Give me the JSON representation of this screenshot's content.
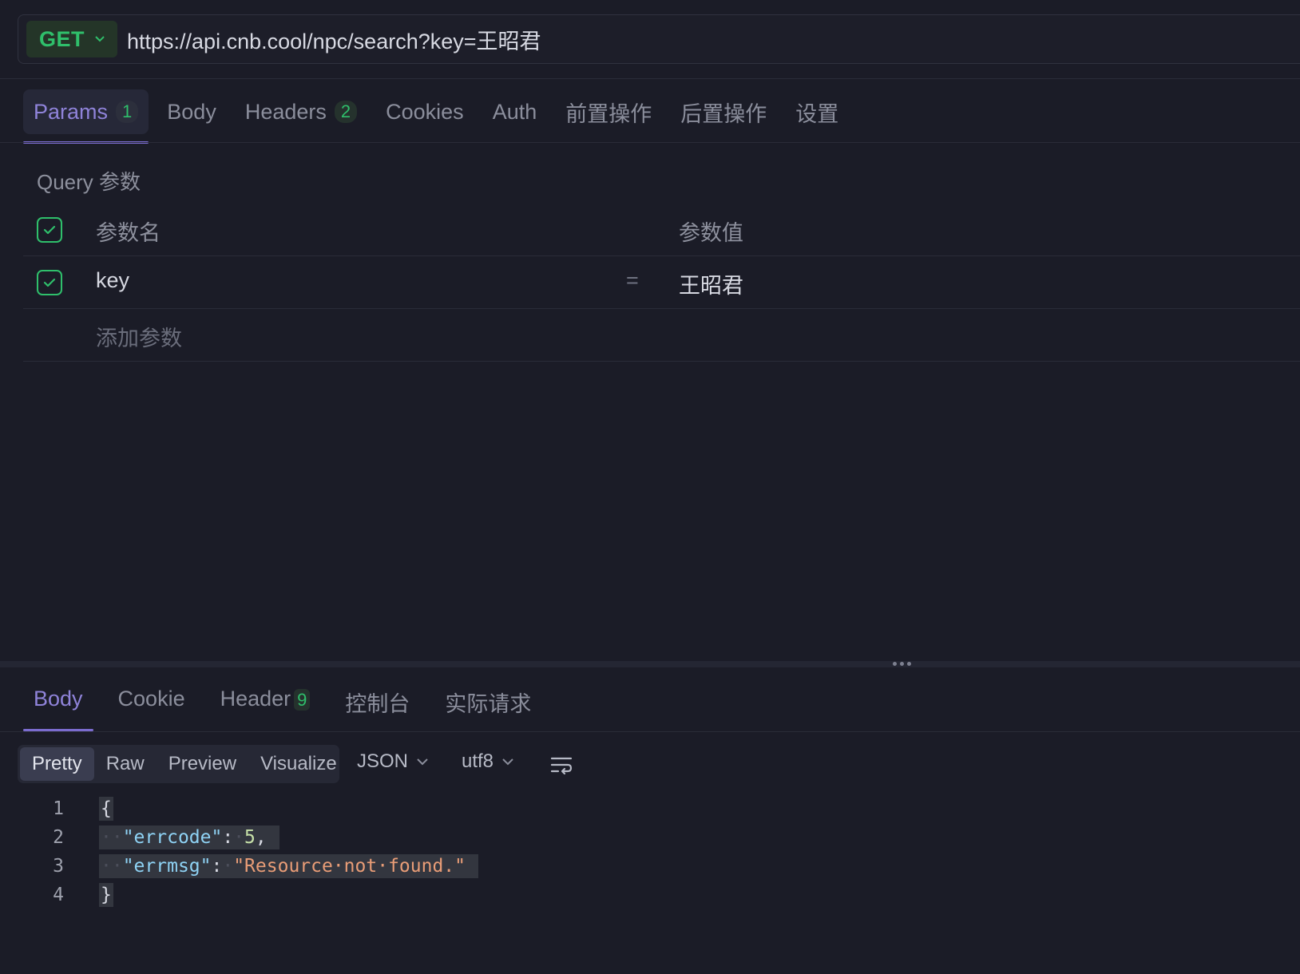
{
  "request": {
    "method": "GET",
    "url": "https://api.cnb.cool/npc/search?key=王昭君"
  },
  "request_tabs": [
    {
      "label": "Params",
      "count": "1",
      "active": true
    },
    {
      "label": "Body"
    },
    {
      "label": "Headers",
      "count": "2"
    },
    {
      "label": "Cookies"
    },
    {
      "label": "Auth"
    },
    {
      "label": "前置操作"
    },
    {
      "label": "后置操作"
    },
    {
      "label": "设置"
    }
  ],
  "params": {
    "section_title": "Query 参数",
    "header_name": "参数名",
    "header_value": "参数值",
    "rows": [
      {
        "name": "key",
        "eq": "=",
        "value": "王昭君"
      }
    ],
    "add_placeholder": "添加参数"
  },
  "response_tabs": [
    {
      "label": "Body",
      "active": true
    },
    {
      "label": "Cookie"
    },
    {
      "label": "Header",
      "count": "9"
    },
    {
      "label": "控制台"
    },
    {
      "label": "实际请求"
    }
  ],
  "view_modes": [
    {
      "label": "Pretty",
      "active": true
    },
    {
      "label": "Raw"
    },
    {
      "label": "Preview"
    },
    {
      "label": "Visualize"
    }
  ],
  "format": "JSON",
  "encoding": "utf8",
  "code_lines": [
    {
      "num": "1",
      "text": "{"
    },
    {
      "num": "2",
      "indent": "··",
      "key": "\"errcode\"",
      "colon": ":",
      "value": "5",
      "tail": ","
    },
    {
      "num": "3",
      "indent": "··",
      "key": "\"errmsg\"",
      "colon": ":",
      "value": "\"Resource·not·found.\""
    },
    {
      "num": "4",
      "text": "}"
    }
  ],
  "icons": [
    "chevron-down-icon",
    "check-icon",
    "wrap-lines-icon",
    "drag-handle-icon"
  ],
  "colors": {
    "accent": "#7b6ccf",
    "method_green": "#2fbf6b",
    "background": "#1b1c27"
  }
}
